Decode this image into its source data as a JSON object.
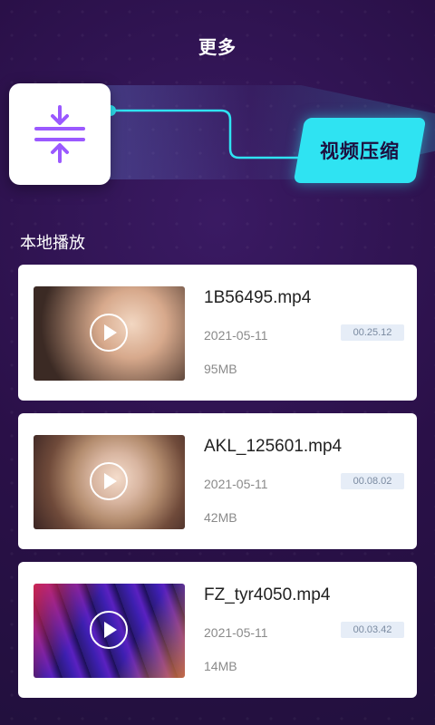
{
  "header": {
    "title": "更多"
  },
  "banner": {
    "feature_label": "视频压缩",
    "icon": "compress-icon"
  },
  "section": {
    "title": "本地播放"
  },
  "videos": [
    {
      "name": "1B56495.mp4",
      "date": "2021-05-11",
      "duration": "00.25.12",
      "size": "95MB"
    },
    {
      "name": "AKL_125601.mp4",
      "date": "2021-05-11",
      "duration": "00.08.02",
      "size": "42MB"
    },
    {
      "name": "FZ_tyr4050.mp4",
      "date": "2021-05-11",
      "duration": "00.03.42",
      "size": "14MB"
    }
  ],
  "colors": {
    "accent": "#2fe3f2",
    "icon_purple": "#9b59ff",
    "background": "#2a1048"
  }
}
